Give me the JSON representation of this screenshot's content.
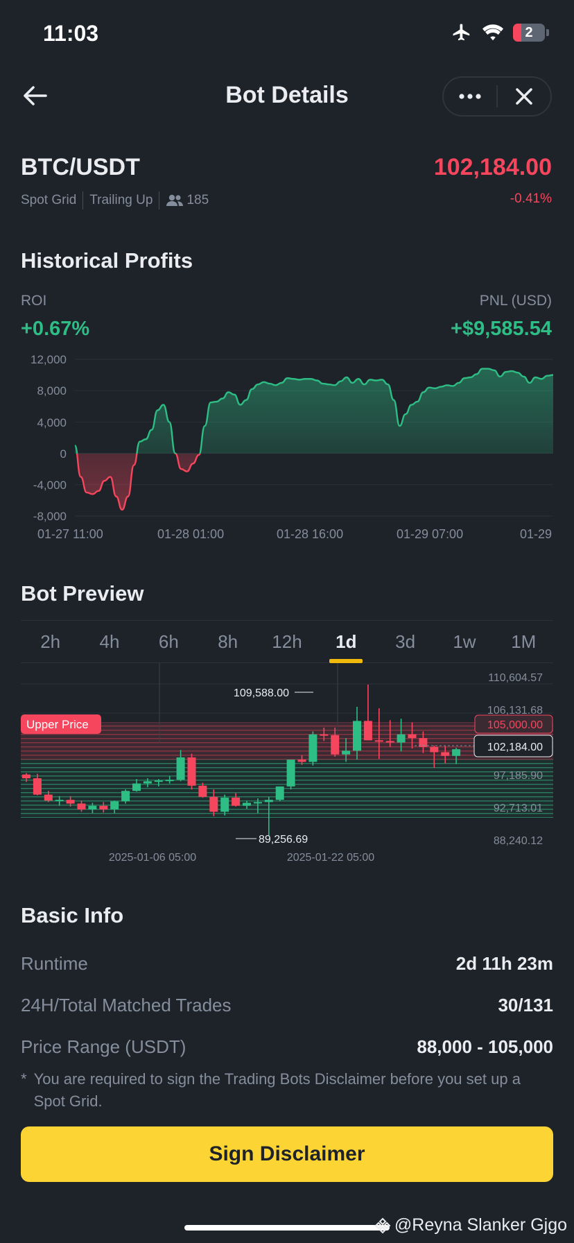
{
  "status_bar": {
    "time": "11:03",
    "battery_level": "2"
  },
  "header": {
    "title": "Bot Details"
  },
  "pair": {
    "symbol": "BTC/USDT",
    "price": "102,184.00",
    "change": "-0.41%",
    "tags": [
      "Spot Grid",
      "Trailing Up"
    ],
    "copiers": "185"
  },
  "historical": {
    "title": "Historical Profits",
    "roi_label": "ROI",
    "roi_value": "+0.67%",
    "pnl_label": "PNL (USD)",
    "pnl_value": "+$9,585.54"
  },
  "profit_chart": {
    "type": "area",
    "y_ticks": [
      "12,000",
      "8,000",
      "4,000",
      "0",
      "-4,000",
      "-8,000"
    ],
    "x_ticks": [
      "01-27 11:00",
      "01-28 01:00",
      "01-28 16:00",
      "01-29 07:00",
      "01-29"
    ],
    "ylim": [
      -8000,
      12000
    ],
    "values": [
      1000,
      -3000,
      -5000,
      -5200,
      -4800,
      -3500,
      -3000,
      -5500,
      -7200,
      -5500,
      -1500,
      1500,
      1800,
      3000,
      5500,
      6200,
      4000,
      0,
      -2000,
      -2300,
      -1300,
      -200,
      3500,
      6500,
      6600,
      7000,
      7800,
      7500,
      6200,
      6800,
      8200,
      8800,
      9100,
      8900,
      8700,
      9000,
      9600,
      9500,
      9400,
      9500,
      9500,
      9300,
      8900,
      8800,
      8700,
      9200,
      9700,
      9000,
      9500,
      8800,
      9400,
      9300,
      9400,
      8800,
      6800,
      3500,
      5000,
      6200,
      6600,
      7800,
      8400,
      8300,
      8500,
      8700,
      8600,
      9000,
      9600,
      9700,
      10100,
      10800,
      10800,
      10600,
      9800,
      10400,
      10500,
      10300,
      9800,
      9000,
      9700,
      9500,
      9900,
      10000
    ]
  },
  "bot_preview": {
    "title": "Bot Preview",
    "tabs": [
      "2h",
      "4h",
      "6h",
      "8h",
      "12h",
      "1d",
      "3d",
      "1w",
      "1M"
    ],
    "active_tab": "1d",
    "upper_price_label": "Upper Price",
    "upper_price_value": "105,000.00",
    "current_price": "102,184.00",
    "high_label": "109,588.00",
    "low_label": "89,256.69",
    "price_axis": [
      "110,604.57",
      "106,131.68",
      "97,185.90",
      "92,713.01",
      "88,240.12"
    ],
    "date_labels": [
      "2025-01-06 05:00",
      "2025-01-22 05:00"
    ],
    "colors": {
      "up": "#2ebd85",
      "down": "#f6465d"
    }
  },
  "candles": {
    "type": "candlestick",
    "ylim": [
      88240.12,
      110604.57
    ],
    "ohlc": [
      [
        97500,
        97700,
        96500,
        97000
      ],
      [
        97000,
        97600,
        94700,
        94800
      ],
      [
        94800,
        95300,
        93800,
        94000
      ],
      [
        94000,
        94600,
        93300,
        94100
      ],
      [
        94100,
        94600,
        93200,
        93600
      ],
      [
        93600,
        94000,
        92500,
        92800
      ],
      [
        92800,
        93700,
        92300,
        93300
      ],
      [
        93300,
        93800,
        92400,
        92800
      ],
      [
        92800,
        94000,
        92300,
        93900
      ],
      [
        93900,
        95500,
        93600,
        95300
      ],
      [
        95300,
        96900,
        95200,
        96300
      ],
      [
        96300,
        97000,
        95800,
        96600
      ],
      [
        96600,
        96900,
        95900,
        96700
      ],
      [
        96700,
        97300,
        96300,
        96800
      ],
      [
        96800,
        100800,
        96600,
        99800
      ],
      [
        99800,
        100300,
        95500,
        96000
      ],
      [
        96000,
        96400,
        94400,
        94500
      ],
      [
        94500,
        95500,
        91900,
        92500
      ],
      [
        92500,
        94800,
        92000,
        94400
      ],
      [
        94400,
        95000,
        93200,
        93300
      ],
      [
        93300,
        94000,
        92900,
        93700
      ],
      [
        93700,
        94300,
        92300,
        93800
      ],
      [
        93800,
        94500,
        89256.69,
        94100
      ],
      [
        94100,
        95500,
        93900,
        95900
      ],
      [
        95900,
        99300,
        95500,
        99500
      ],
      [
        99500,
        100100,
        98800,
        99200
      ],
      [
        99200,
        103300,
        98700,
        102900
      ],
      [
        102900,
        103800,
        102000,
        102800
      ],
      [
        102800,
        103800,
        99900,
        100200
      ],
      [
        100200,
        102400,
        99200,
        100700
      ],
      [
        100700,
        106600,
        99500,
        104700
      ],
      [
        104700,
        109588,
        102700,
        102100
      ],
      [
        102100,
        106400,
        99600,
        102000
      ],
      [
        102000,
        104800,
        101200,
        101800
      ],
      [
        101800,
        105000,
        100600,
        102900
      ],
      [
        102900,
        104500,
        101000,
        102400
      ],
      [
        102400,
        103300,
        100400,
        101200
      ],
      [
        101200,
        101400,
        98400,
        100500
      ],
      [
        100500,
        101300,
        99000,
        100000
      ],
      [
        100000,
        101100,
        98900,
        100900
      ]
    ]
  },
  "basic_info": {
    "title": "Basic Info",
    "rows": [
      {
        "label": "Runtime",
        "value": "2d 11h 23m"
      },
      {
        "label": "24H/Total Matched Trades",
        "value": "30/131"
      },
      {
        "label": "Price Range (USDT)",
        "value": "88,000 - 105,000"
      }
    ],
    "disclaimer_mark": "*",
    "disclaimer": "You are required to sign the Trading Bots Disclaimer before you set up a Spot Grid.",
    "button": "Sign Disclaimer"
  },
  "watermark": "@Reyna Slanker Gjgo"
}
